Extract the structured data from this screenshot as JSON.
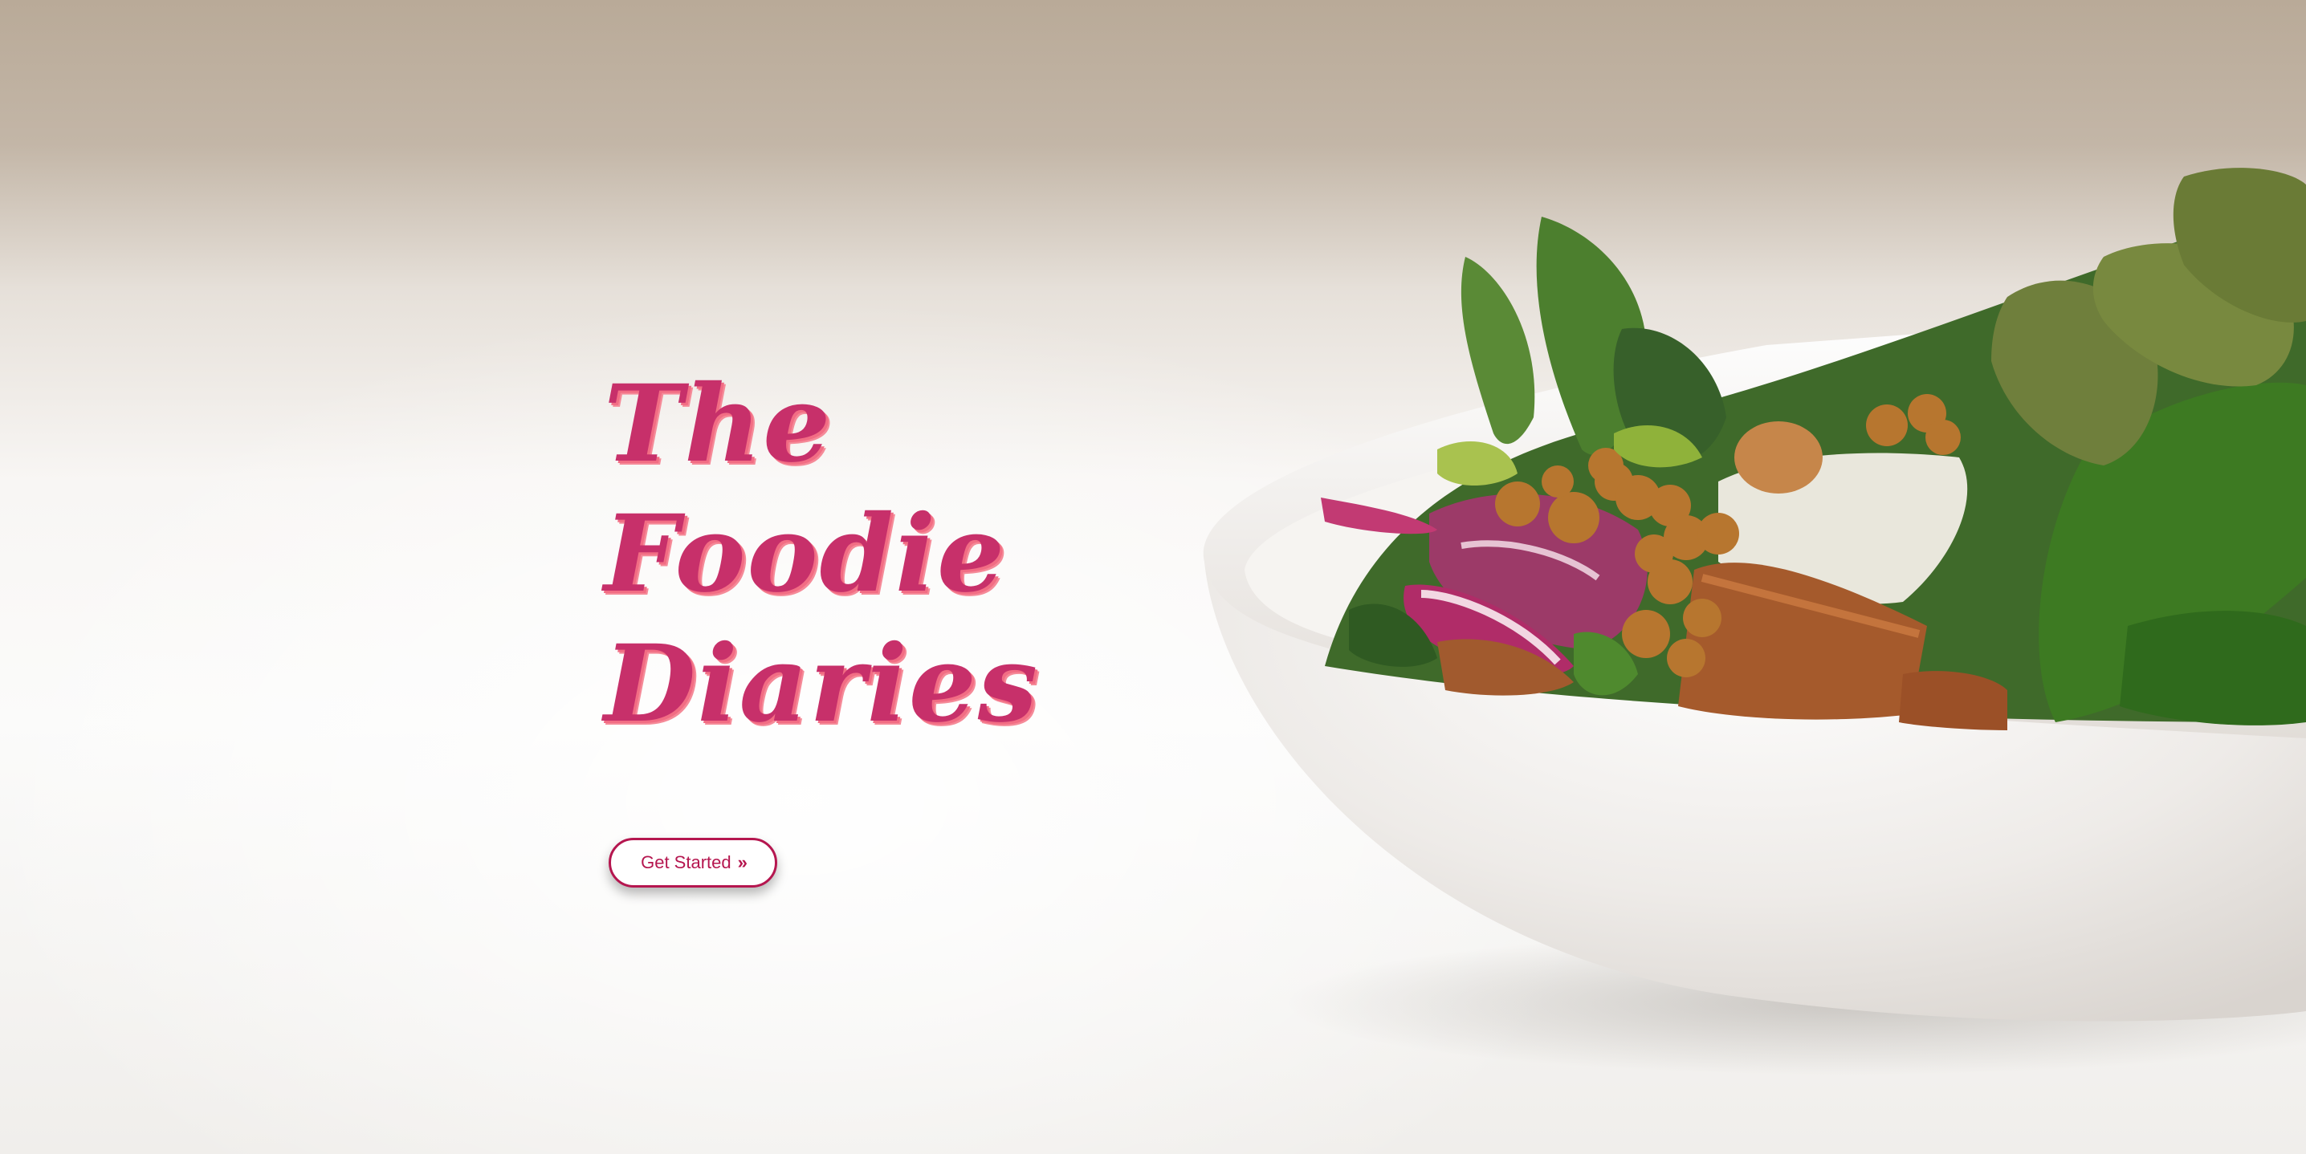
{
  "hero": {
    "title_lines": [
      "The",
      "Foodie",
      "Diaries"
    ],
    "cta": {
      "label": "Get Started",
      "icon": "double-chevron-right-icon",
      "glyph": "»"
    }
  },
  "colors": {
    "title": "#c7306a",
    "title_shadow": "#f26d84",
    "button_border": "#b5164f",
    "button_text": "#b5164f"
  },
  "image": {
    "subject": "salad-bowl-photo"
  }
}
